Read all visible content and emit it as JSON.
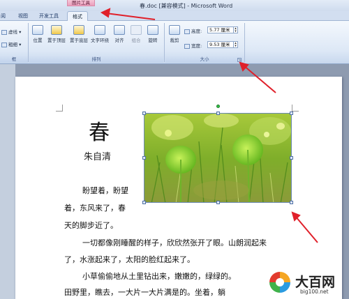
{
  "window": {
    "title": "春.doc [兼容模式] - Microsoft Word",
    "context_tab_group": "图片工具"
  },
  "tabs": [
    {
      "label": "阅"
    },
    {
      "label": "视图"
    },
    {
      "label": "开发工具"
    },
    {
      "label": "格式",
      "active": true
    }
  ],
  "ribbon": {
    "border_label": "虚线",
    "weight_label": "粗细",
    "group_edge_label": "框",
    "arrange_buttons": [
      "位置",
      "置于顶层",
      "置于底层",
      "文字环绕",
      "对齐",
      "组合",
      "旋转"
    ],
    "arrange_group_label": "排列",
    "crop_label": "裁剪",
    "height_label": "高度:",
    "height_value": "5.77 厘米",
    "width_label": "宽度:",
    "width_value": "9.53 厘米",
    "size_group_label": "大小"
  },
  "document": {
    "heading": "春",
    "author": "朱自清",
    "lines": [
      "盼望着，盼望",
      "着，东风来了，春",
      "天的脚步近了。",
      "一切都像刚睡醒的样子，欣欣然张开了眼。山朗润起来",
      "了，水涨起来了，太阳的脸红起来了。",
      "小草偷偷地从土里钻出来，嫩嫩的，绿绿的。",
      "田野里，瞧去，一大片一大片满是的。坐着，躺"
    ]
  },
  "watermark": {
    "name": "大百网",
    "url": "big100.net"
  },
  "colors": {
    "ribbon_bg": "#dde8f6",
    "context_tab": "#ea9fbc",
    "annotation_arrow": "#e0202a",
    "selection_handle": "#4f6fa3",
    "rotate_handle": "#35c04a"
  }
}
